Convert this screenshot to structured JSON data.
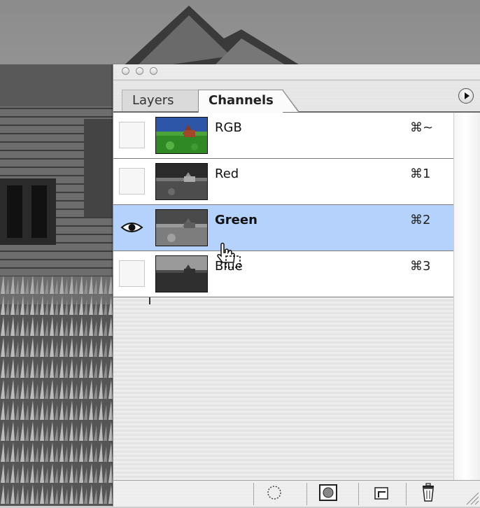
{
  "palette": {
    "window_controls": [
      "close",
      "minimize",
      "zoom"
    ],
    "tabs": [
      {
        "label": "Layers",
        "active": false
      },
      {
        "label": "Channels",
        "active": true
      }
    ],
    "menu_icon": "palette-menu-arrow-icon"
  },
  "channels": [
    {
      "name": "RGB",
      "shortcut": "⌘~",
      "visible": false,
      "selected": false,
      "thumb_color": "color"
    },
    {
      "name": "Red",
      "shortcut": "⌘1",
      "visible": false,
      "selected": false,
      "thumb_color": "gray"
    },
    {
      "name": "Green",
      "shortcut": "⌘2",
      "visible": true,
      "selected": true,
      "thumb_color": "gray"
    },
    {
      "name": "Blue",
      "shortcut": "⌘3",
      "visible": false,
      "selected": false,
      "thumb_color": "gray"
    }
  ],
  "toolbar": {
    "buttons": [
      {
        "icon": "load-channel-as-selection-icon"
      },
      {
        "icon": "save-selection-as-channel-icon"
      },
      {
        "icon": "new-channel-icon"
      },
      {
        "icon": "delete-channel-icon"
      }
    ]
  },
  "colors": {
    "selection": "#b4d2fb",
    "panel": "#e6e6e6"
  }
}
